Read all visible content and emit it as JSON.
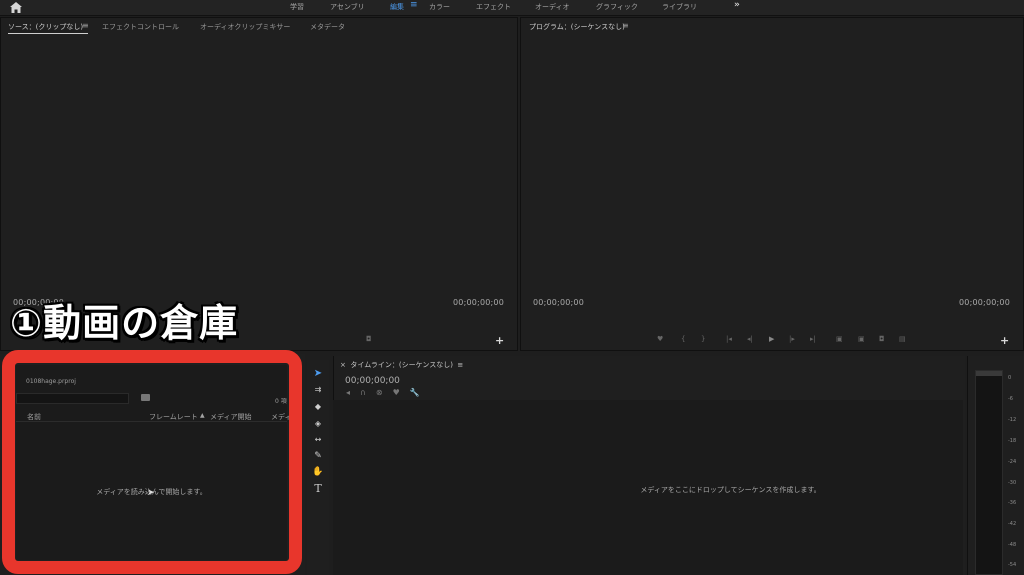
{
  "workspaces": {
    "items": [
      "学習",
      "アセンブリ",
      "編集",
      "カラー",
      "エフェクト",
      "オーディオ",
      "グラフィック",
      "ライブラリ"
    ],
    "active": "編集",
    "menu_glyph": "≡",
    "more_glyph": "»"
  },
  "source_panel": {
    "tabs": [
      "ソース：(クリップなし)",
      "エフェクトコントロール",
      "オーディオクリップミキサー",
      "メタデータ"
    ],
    "timecode_left": "00;00;00;00",
    "timecode_right": "00;00;00;00",
    "add_glyph": "+"
  },
  "program_panel": {
    "title": "プログラム：(シーケンスなし)",
    "timecode_left": "00;00;00;00",
    "timecode_right": "00;00;00;00",
    "add_glyph": "+"
  },
  "annotation": {
    "text": "①動画の倉庫"
  },
  "project_panel": {
    "file_name": "0108hage.prproj",
    "item_count": "0 項",
    "columns": [
      "名前",
      "フレームレート",
      "メディア開始",
      "メディ"
    ],
    "empty_message": "メディアを読み込んで開始します。"
  },
  "timeline_panel": {
    "title": "タイムライン：(シーケンスなし)",
    "timecode": "00;00;00;00",
    "empty_message": "メディアをここにドロップしてシーケンスを作成します。"
  },
  "audio_meter": {
    "ticks": [
      "0",
      "-6",
      "-12",
      "-18",
      "-24",
      "-30",
      "-36",
      "-42",
      "-48",
      "-54"
    ]
  },
  "colors": {
    "highlight": "#e8362c",
    "accent": "#4d9cf0",
    "panel_bg": "#1f1f1f"
  },
  "icons": [
    "home-icon",
    "selection-tool-icon",
    "track-select-icon",
    "ripple-edit-icon",
    "razor-icon",
    "slip-icon",
    "pen-icon",
    "hand-icon",
    "type-icon",
    "wrench-icon",
    "bin-icon"
  ]
}
